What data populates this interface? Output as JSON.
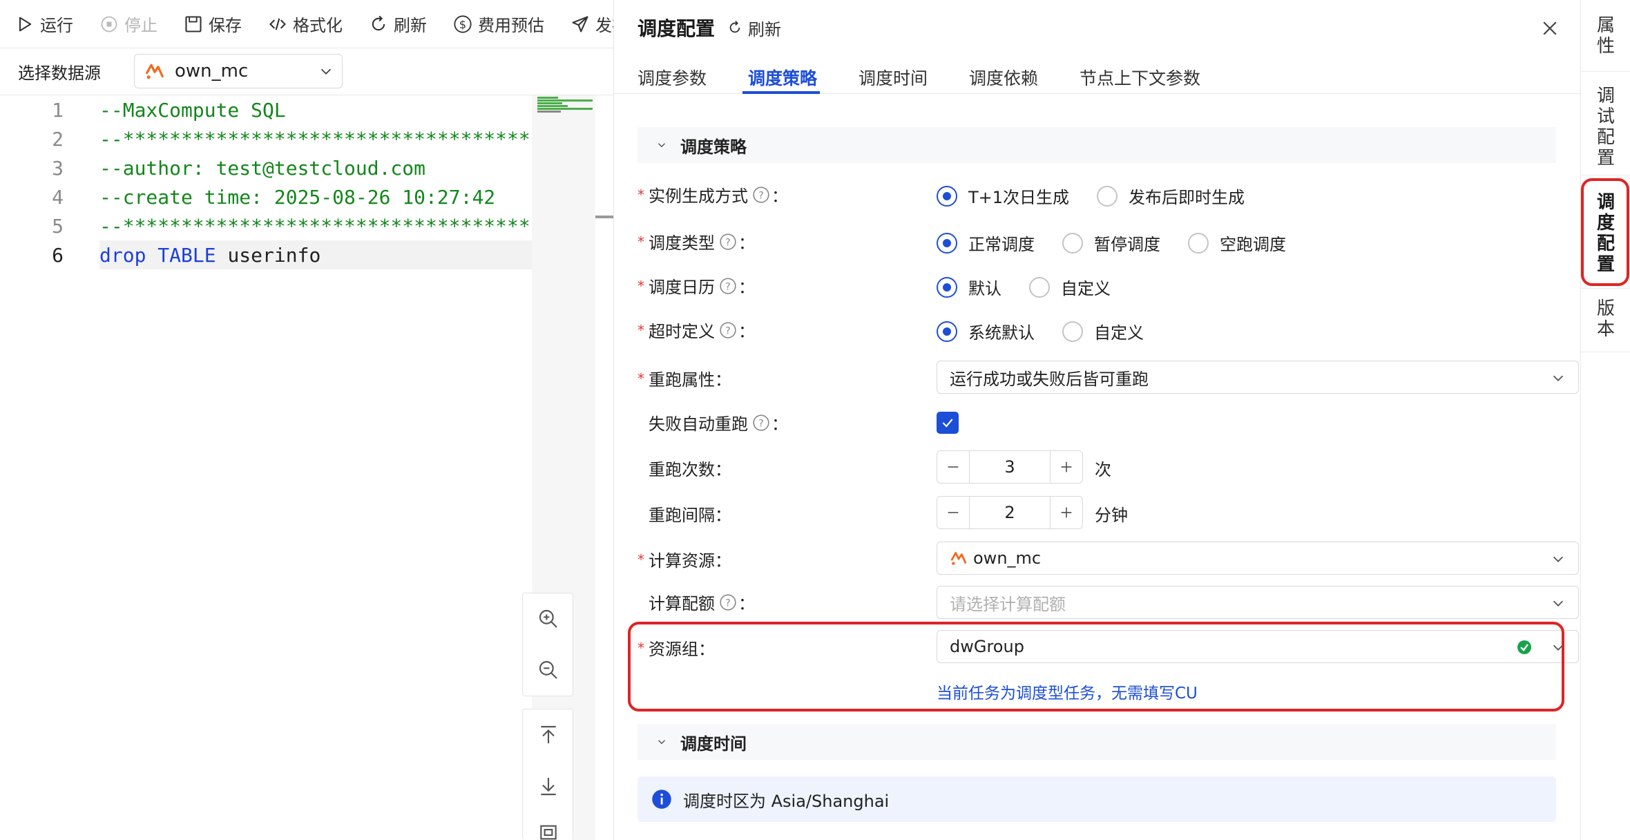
{
  "toolbar": {
    "run": "运行",
    "stop": "停止",
    "save": "保存",
    "format": "格式化",
    "refresh": "刷新",
    "cost": "费用预估",
    "publish": "发布"
  },
  "datasource": {
    "label": "选择数据源",
    "value": "own_mc"
  },
  "editor": {
    "lines": [
      {
        "num": "1",
        "text": "--MaxCompute SQL"
      },
      {
        "num": "2",
        "text": "--********************************************************************--"
      },
      {
        "num": "3",
        "text": "--author: test@testcloud.com"
      },
      {
        "num": "4",
        "text": "--create time: 2025-08-26 10:27:42"
      },
      {
        "num": "5",
        "text": "--********************************************************************--"
      },
      {
        "num": "6",
        "kw1": "drop",
        "kw2": "TABLE",
        "ident": "userinfo"
      }
    ]
  },
  "panel": {
    "title": "调度配置",
    "refresh": "刷新",
    "tabs": [
      "调度参数",
      "调度策略",
      "调度时间",
      "调度依赖",
      "节点上下文参数"
    ],
    "active_tab": "调度策略",
    "sections": {
      "policy": "调度策略",
      "time": "调度时间"
    },
    "fields": {
      "instance_gen": {
        "label": "实例生成方式",
        "options": [
          "T+1次日生成",
          "发布后即时生成"
        ],
        "selected": "T+1次日生成"
      },
      "schedule_type": {
        "label": "调度类型",
        "options": [
          "正常调度",
          "暂停调度",
          "空跑调度"
        ],
        "selected": "正常调度"
      },
      "calendar": {
        "label": "调度日历",
        "options": [
          "默认",
          "自定义"
        ],
        "selected": "默认"
      },
      "timeout": {
        "label": "超时定义",
        "options": [
          "系统默认",
          "自定义"
        ],
        "selected": "系统默认"
      },
      "rerun": {
        "label": "重跑属性",
        "value": "运行成功或失败后皆可重跑"
      },
      "auto_rerun": {
        "label": "失败自动重跑",
        "checked": true
      },
      "rerun_count": {
        "label": "重跑次数",
        "value": "3",
        "unit": "次"
      },
      "rerun_interval": {
        "label": "重跑间隔",
        "value": "2",
        "unit": "分钟"
      },
      "compute": {
        "label": "计算资源",
        "value": "own_mc"
      },
      "quota": {
        "label": "计算配额",
        "placeholder": "请选择计算配额"
      },
      "resource_group": {
        "label": "资源组",
        "value": "dwGroup",
        "hint": "当前任务为调度型任务，无需填写CU"
      }
    },
    "timezone_info": "调度时区为 Asia/Shanghai"
  },
  "side_tabs": [
    {
      "chars": [
        "属",
        "性"
      ]
    },
    {
      "chars": [
        "调",
        "试",
        "配",
        "置"
      ]
    },
    {
      "chars": [
        "调",
        "度",
        "配",
        "置"
      ],
      "active": true
    },
    {
      "chars": [
        "版",
        "本"
      ]
    }
  ],
  "colors": {
    "accent": "#1d4ed8",
    "highlight": "#e02424",
    "code_comment": "#14861c",
    "keyword": "#1c3edb"
  }
}
